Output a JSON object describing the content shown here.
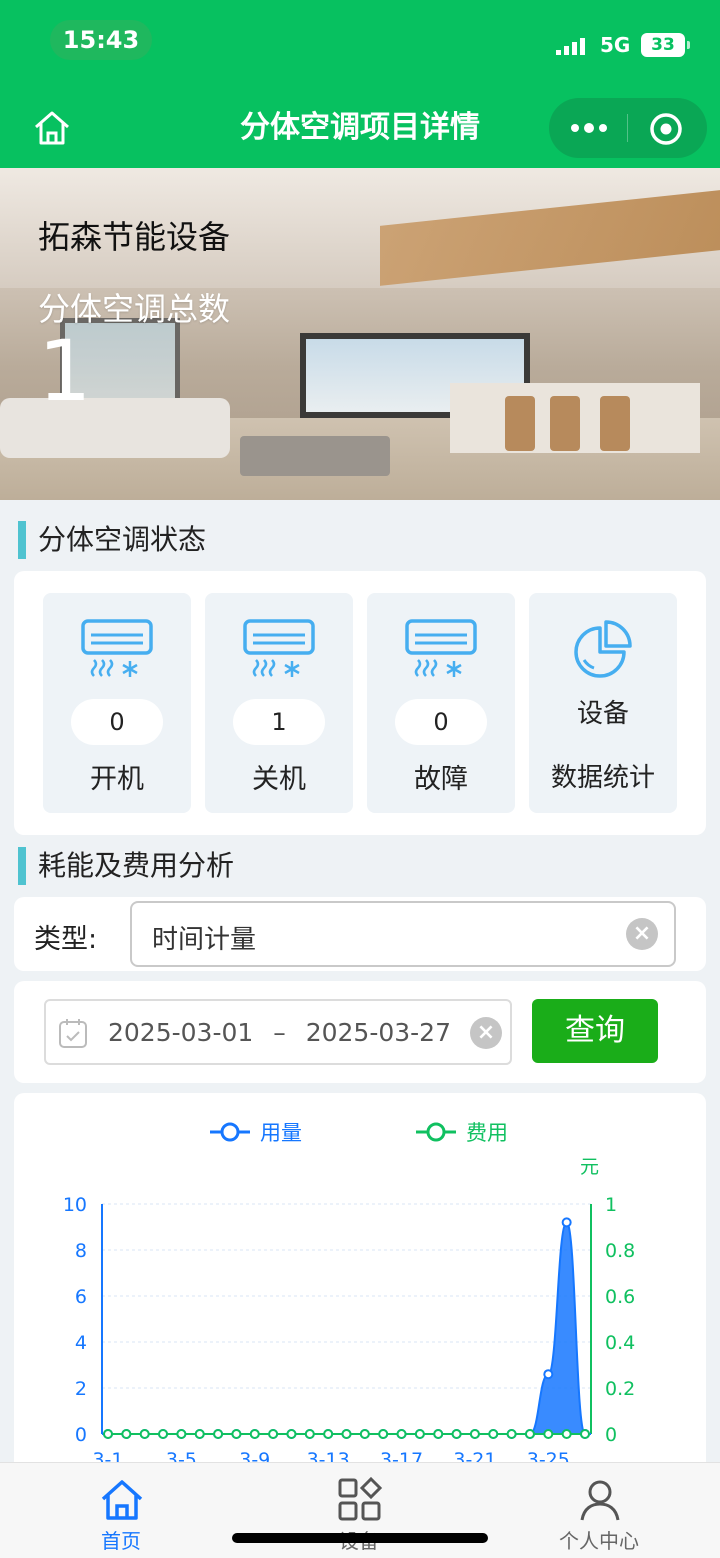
{
  "status_bar": {
    "time": "15:43",
    "network": "5G",
    "battery": "33"
  },
  "nav": {
    "title": "分体空调项目详情"
  },
  "banner": {
    "company": "拓森节能设备",
    "total_label": "分体空调总数",
    "total_count": "1"
  },
  "status_section": {
    "title": "分体空调状态",
    "tiles": [
      {
        "count": "0",
        "label": "开机",
        "icon": "air-conditioner-icon"
      },
      {
        "count": "1",
        "label": "关机",
        "icon": "air-conditioner-icon"
      },
      {
        "count": "0",
        "label": "故障",
        "icon": "air-conditioner-icon"
      },
      {
        "line1": "设备",
        "line2": "数据统计",
        "icon": "pie-chart-icon"
      }
    ]
  },
  "analysis_section": {
    "title": "耗能及费用分析",
    "type_label": "类型:",
    "type_value": "时间计量",
    "date_start": "2025-03-01",
    "date_sep": "–",
    "date_end": "2025-03-27",
    "query_label": "查询"
  },
  "colors": {
    "brand_green": "#07c160",
    "usage_blue": "#1677ff",
    "cost_green": "#10c060",
    "query_green": "#1aad19"
  },
  "chart_data": {
    "type": "area",
    "legend": [
      "用量",
      "费用"
    ],
    "y2_unit": "元",
    "ylim": [
      0,
      10
    ],
    "y_ticks": [
      "10",
      "8",
      "6",
      "4",
      "2",
      "0"
    ],
    "y2lim": [
      0,
      1
    ],
    "y2_ticks": [
      "1",
      "0.8",
      "0.6",
      "0.4",
      "0.2",
      "0"
    ],
    "x_tick_labels": [
      "3-1",
      "3-5",
      "3-9",
      "3-13",
      "3-17",
      "3-21",
      "3-25"
    ],
    "x": [
      "3-1",
      "3-2",
      "3-3",
      "3-4",
      "3-5",
      "3-6",
      "3-7",
      "3-8",
      "3-9",
      "3-10",
      "3-11",
      "3-12",
      "3-13",
      "3-14",
      "3-15",
      "3-16",
      "3-17",
      "3-18",
      "3-19",
      "3-20",
      "3-21",
      "3-22",
      "3-23",
      "3-24",
      "3-25",
      "3-26",
      "3-27"
    ],
    "series": [
      {
        "name": "用量",
        "axis": "left",
        "values": [
          0,
          0,
          0,
          0,
          0,
          0,
          0,
          0,
          0,
          0,
          0,
          0,
          0,
          0,
          0,
          0,
          0,
          0,
          0,
          0,
          0,
          0,
          0,
          0,
          2.6,
          9.2,
          0
        ]
      },
      {
        "name": "费用",
        "axis": "right",
        "values": [
          0,
          0,
          0,
          0,
          0,
          0,
          0,
          0,
          0,
          0,
          0,
          0,
          0,
          0,
          0,
          0,
          0,
          0,
          0,
          0,
          0,
          0,
          0,
          0,
          0,
          0,
          0
        ]
      }
    ],
    "grid": true,
    "legend_position": "top"
  },
  "tabbar": {
    "items": [
      {
        "label": "首页",
        "icon": "home-icon",
        "active": true
      },
      {
        "label": "设备",
        "icon": "device-grid-icon",
        "active": false
      },
      {
        "label": "个人中心",
        "icon": "user-icon",
        "active": false
      }
    ]
  }
}
